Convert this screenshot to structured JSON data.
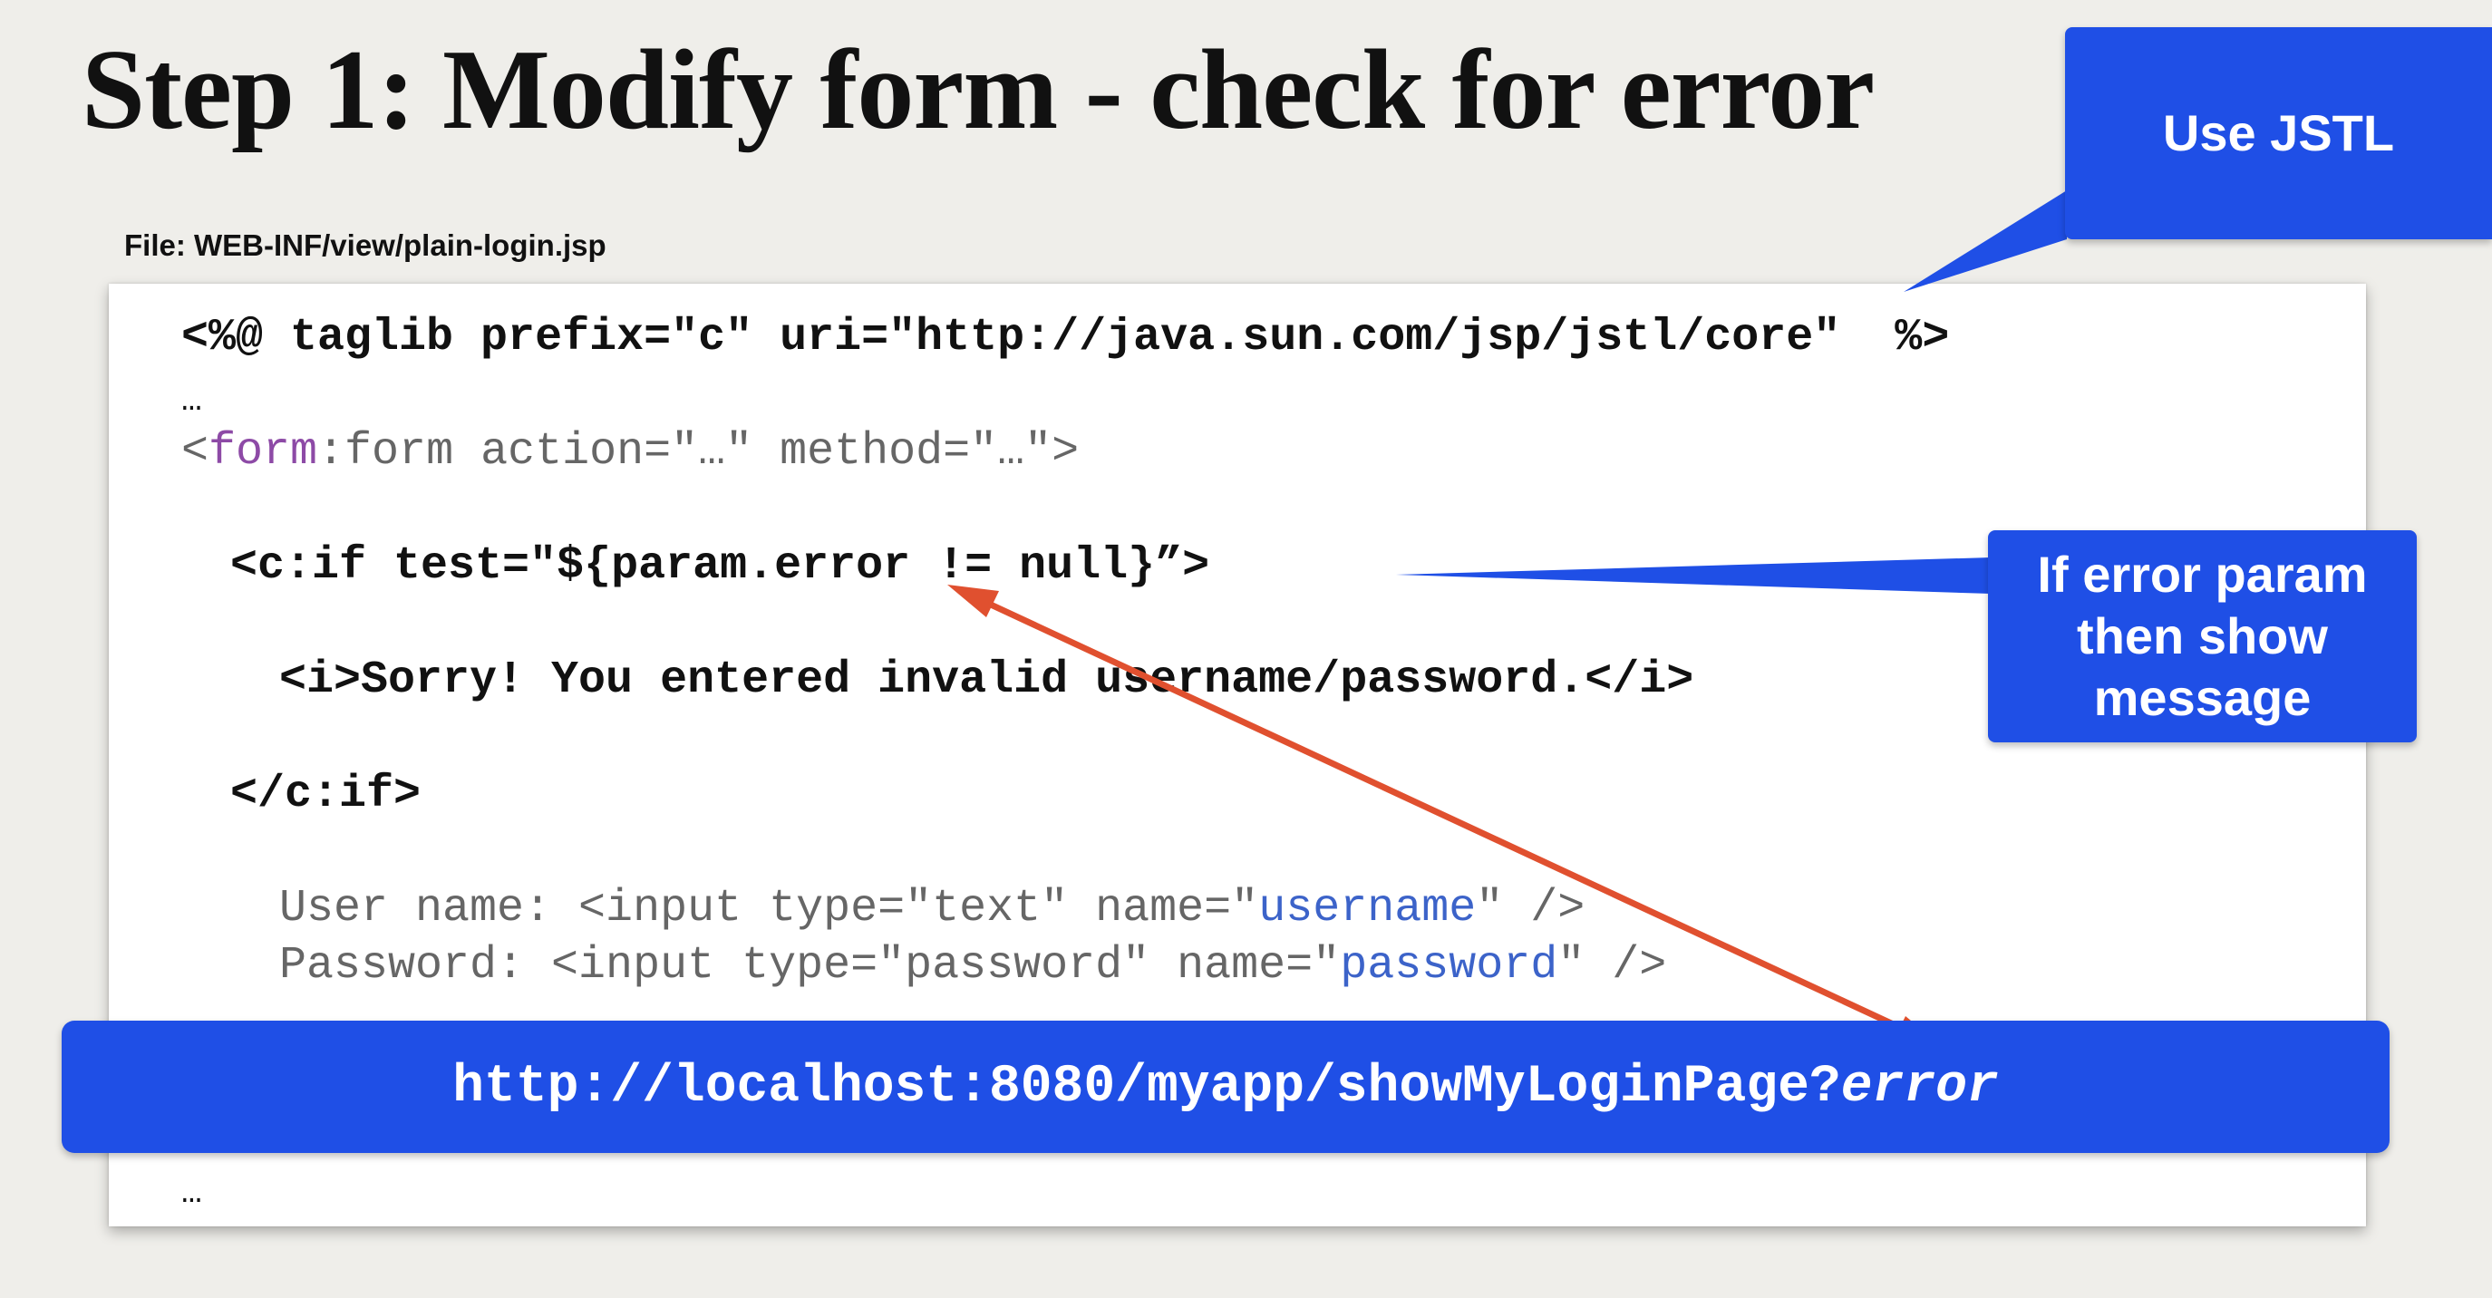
{
  "slide": {
    "title": "Step 1: Modify form - check for error",
    "file_label": "File: WEB-INF/view/plain-login.jsp"
  },
  "code": {
    "line1": "<%@ taglib prefix=\"c\" uri=\"http://java.sun.com/jsp/jstl/core\"  %>",
    "ellipsis_top": "…",
    "form_open": "<",
    "form_prefix": "form",
    "form_rest": ":form action=\"…\" method=\"…\">",
    "if_open": "<c:if test=\"${param.error != null}”>",
    "message": "<i>Sorry! You entered invalid username/password.</i>",
    "if_close": "</c:if>",
    "user_prefix": "User name: <input type=\"text\" name=\"",
    "user_name": "username",
    "user_suffix": "\" />",
    "pass_prefix": "Password: <input type=\"password\" name=\"",
    "pass_name": "password",
    "pass_suffix": "\" />",
    "ellipsis_bottom": "…"
  },
  "url_bar": {
    "url_main": "http://localhost:8080/myapp/showMyLoginPage?",
    "url_param": "error"
  },
  "callouts": {
    "jstl": "Use JSTL",
    "error": "If error param\nthen show\nmessage"
  },
  "colors": {
    "callout_blue": "#1f4fe6",
    "arrow_red": "#e0502f",
    "jsp_purple": "#8d4aa6",
    "attr_blue": "#3c63c9"
  }
}
